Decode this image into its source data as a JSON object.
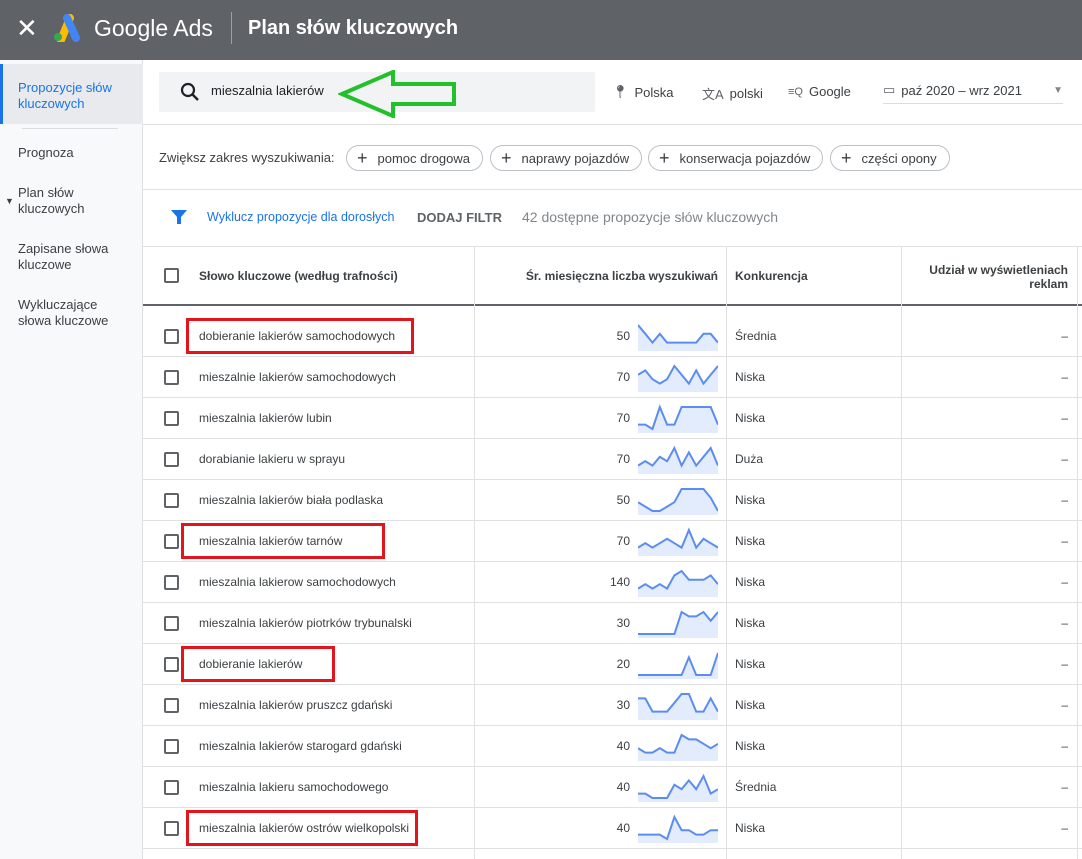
{
  "header": {
    "brand": "Google Ads",
    "title": "Plan słów kluczowych",
    "close_icon": "close-icon"
  },
  "sidebar": {
    "items": [
      {
        "label": "Propozycje słów kluczowych",
        "active": true
      },
      {
        "label": "Prognoza"
      },
      {
        "label": "Plan słów kluczowych"
      },
      {
        "label": "Zapisane słowa kluczowe"
      },
      {
        "label": "Wykluczające słowa kluczowe"
      }
    ]
  },
  "search": {
    "value": "mieszalnia lakierów"
  },
  "options": {
    "location": "Polska",
    "language": "polski",
    "network": "Google",
    "date_range": "paź 2020 – wrz 2021"
  },
  "broaden": {
    "label": "Zwiększ zakres wyszukiwania:",
    "chips": [
      "pomoc drogowa",
      "naprawy pojazdów",
      "konserwacja pojazdów",
      "części opony"
    ]
  },
  "filters": {
    "adult": "Wyklucz propozycje dla dorosłych",
    "add": "DODAJ FILTR",
    "count": "42 dostępne propozycje słów kluczowych"
  },
  "table": {
    "headers": {
      "keyword": "Słowo kluczowe (według trafności)",
      "volume": "Śr. miesięczna liczba wyszukiwań",
      "competition": "Konkurencja",
      "share": "Udział w wyświetleniach reklam"
    },
    "rows": [
      {
        "keyword": "dobieranie lakierów samochodowych",
        "volume": "50",
        "competition": "Średnia",
        "share": "–",
        "highlighted": true,
        "trend": [
          5,
          3,
          1,
          3,
          1,
          1,
          1,
          1,
          1,
          3,
          3,
          1
        ]
      },
      {
        "keyword": "mieszalnie lakierów samochodowych",
        "volume": "70",
        "competition": "Niska",
        "share": "–",
        "highlighted": false,
        "trend": [
          3,
          4,
          2,
          1,
          2,
          5,
          3,
          1,
          4,
          1,
          3,
          5
        ]
      },
      {
        "keyword": "mieszalnia lakierów lubin",
        "volume": "70",
        "competition": "Niska",
        "share": "–",
        "highlighted": false,
        "trend": [
          1,
          1,
          0,
          5,
          1,
          1,
          5,
          5,
          5,
          5,
          5,
          1
        ]
      },
      {
        "keyword": "dorabianie lakieru w sprayu",
        "volume": "70",
        "competition": "Duża",
        "share": "–",
        "highlighted": false,
        "trend": [
          1,
          2,
          1,
          3,
          2,
          5,
          1,
          4,
          1,
          3,
          5,
          1
        ]
      },
      {
        "keyword": "mieszalnia lakierów biała podlaska",
        "volume": "50",
        "competition": "Niska",
        "share": "–",
        "highlighted": false,
        "trend": [
          2,
          1,
          0,
          0,
          1,
          2,
          5,
          5,
          5,
          5,
          3,
          0
        ]
      },
      {
        "keyword": "mieszalnia lakierów tarnów",
        "volume": "70",
        "competition": "Niska",
        "share": "–",
        "highlighted": true,
        "trend": [
          1,
          2,
          1,
          2,
          3,
          2,
          1,
          5,
          1,
          3,
          2,
          1
        ]
      },
      {
        "keyword": "mieszalnia lakierow samochodowych",
        "volume": "140",
        "competition": "Niska",
        "share": "–",
        "highlighted": false,
        "trend": [
          1,
          2,
          1,
          2,
          1,
          4,
          5,
          3,
          3,
          3,
          4,
          2
        ]
      },
      {
        "keyword": "mieszalnia lakierów piotrków trybunalski",
        "volume": "30",
        "competition": "Niska",
        "share": "–",
        "highlighted": false,
        "trend": [
          0,
          0,
          0,
          0,
          0,
          0,
          5,
          4,
          4,
          5,
          3,
          5
        ]
      },
      {
        "keyword": "dobieranie lakierów",
        "volume": "20",
        "competition": "Niska",
        "share": "–",
        "highlighted": true,
        "trend": [
          0,
          0,
          0,
          0,
          0,
          0,
          0,
          4,
          0,
          0,
          0,
          5
        ]
      },
      {
        "keyword": "mieszalnia lakierów pruszcz gdański",
        "volume": "30",
        "competition": "Niska",
        "share": "–",
        "highlighted": false,
        "trend": [
          4,
          4,
          1,
          1,
          1,
          3,
          5,
          5,
          1,
          1,
          4,
          1
        ]
      },
      {
        "keyword": "mieszalnia lakierów starogard gdański",
        "volume": "40",
        "competition": "Niska",
        "share": "–",
        "highlighted": false,
        "trend": [
          2,
          1,
          1,
          2,
          1,
          1,
          5,
          4,
          4,
          3,
          2,
          3
        ]
      },
      {
        "keyword": "mieszalnia lakieru samochodowego",
        "volume": "40",
        "competition": "Średnia",
        "share": "–",
        "highlighted": false,
        "trend": [
          1,
          1,
          0,
          0,
          0,
          3,
          2,
          4,
          2,
          5,
          1,
          2
        ]
      },
      {
        "keyword": "mieszalnia lakierów ostrów wielkopolski",
        "volume": "40",
        "competition": "Niska",
        "share": "–",
        "highlighted": true,
        "trend": [
          1,
          1,
          1,
          1,
          0,
          5,
          2,
          2,
          1,
          1,
          2,
          2
        ]
      }
    ]
  },
  "colors": {
    "header_bg": "#5f6368",
    "accent": "#1a73e8",
    "spark": "#5b8def",
    "highlight": "#e3141c",
    "arrow": "#22c02a"
  }
}
